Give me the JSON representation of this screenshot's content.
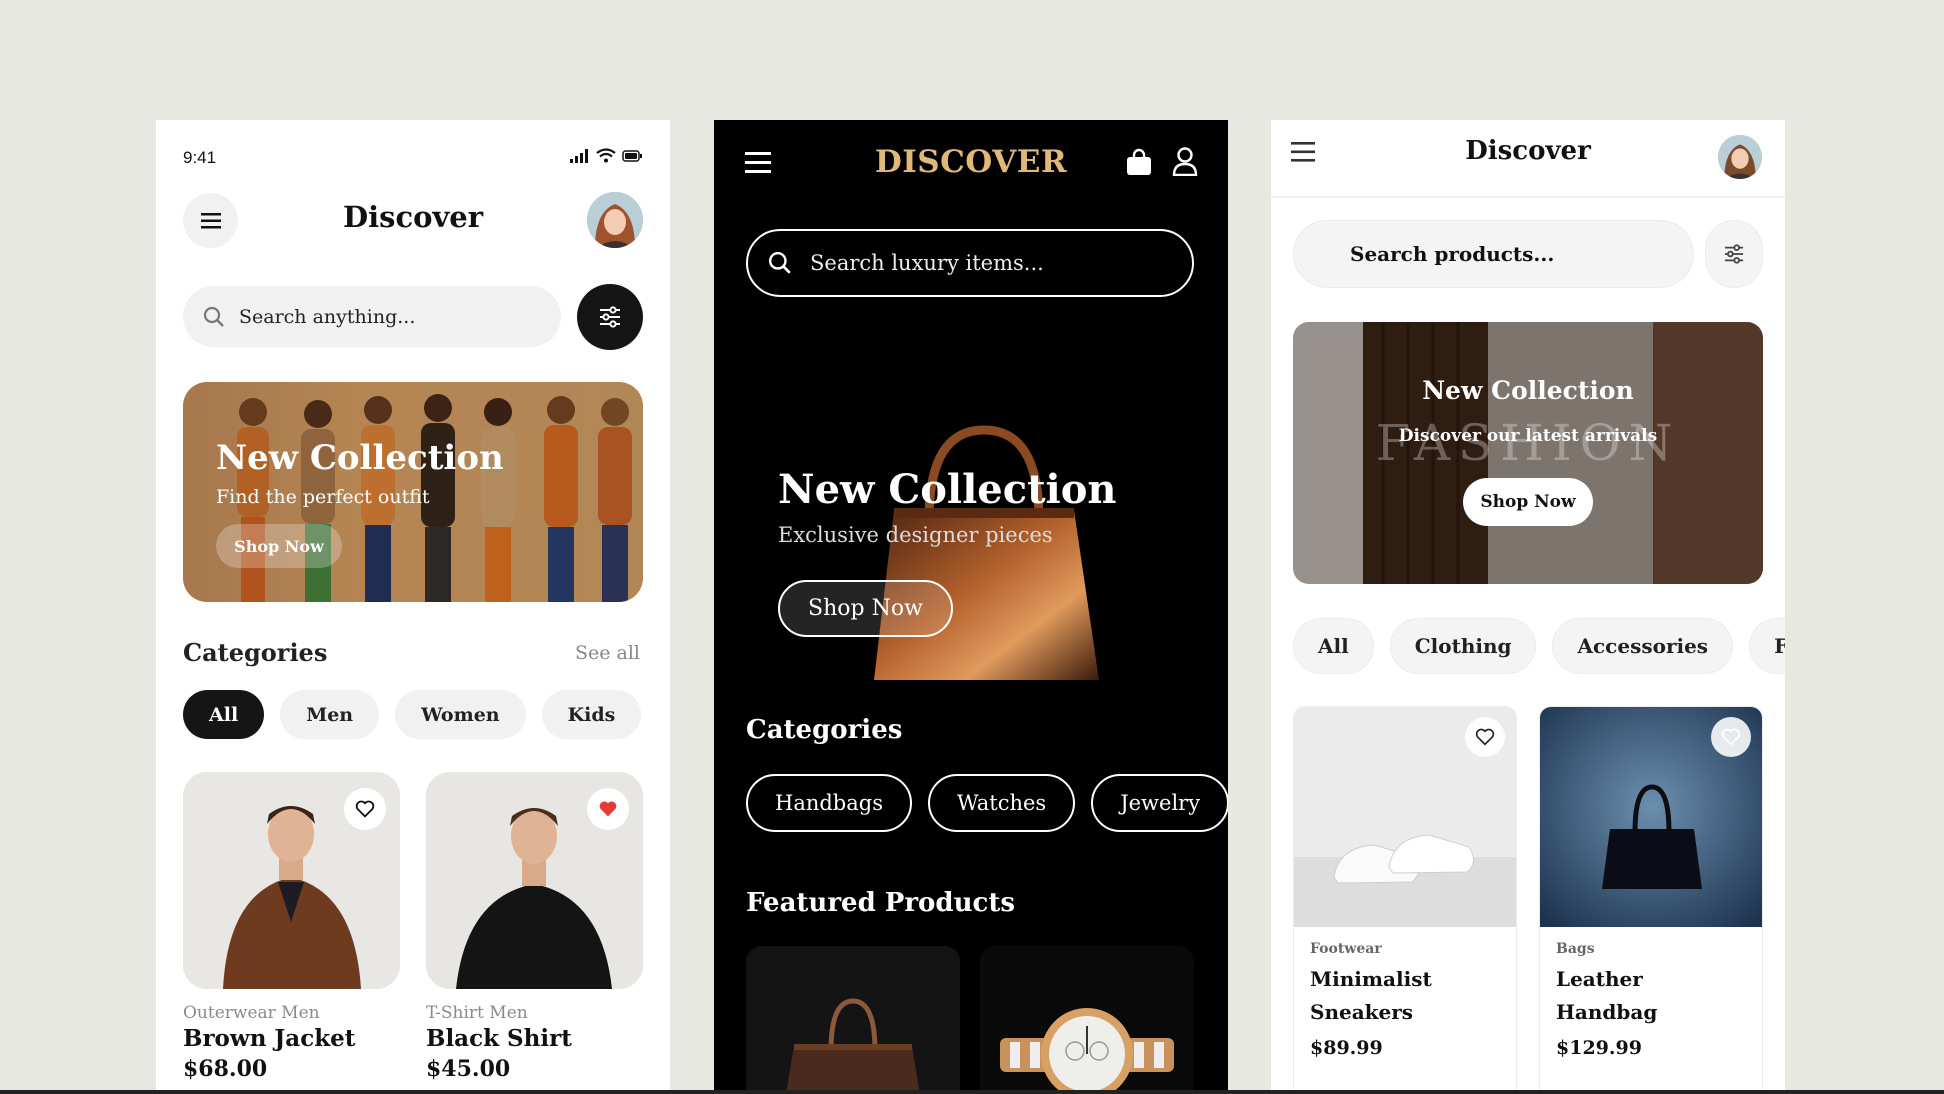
{
  "phone1": {
    "time": "9:41",
    "title": "Discover",
    "search_placeholder": "Search anything...",
    "banner": {
      "title": "New Collection",
      "subtitle": "Find the perfect outfit",
      "button": "Shop Now"
    },
    "categories_title": "Categories",
    "see_all": "See all",
    "chips": [
      "All",
      "Men",
      "Women",
      "Kids"
    ],
    "products": [
      {
        "category": "Outerwear Men",
        "name": "Brown Jacket",
        "price": "$68.00",
        "favorited": false
      },
      {
        "category": "T-Shirt Men",
        "name": "Black Shirt",
        "price": "$45.00",
        "favorited": true
      }
    ]
  },
  "phone2": {
    "brand": "DISCOVER",
    "search_placeholder": "Search luxury items...",
    "hero": {
      "title": "New Collection",
      "subtitle": "Exclusive designer pieces",
      "button": "Shop Now"
    },
    "categories_title": "Categories",
    "chips": [
      "Handbags",
      "Watches",
      "Jewelry"
    ],
    "featured_title": "Featured Products"
  },
  "phone3": {
    "title": "Discover",
    "search_placeholder": "Search products...",
    "banner": {
      "title": "New Collection",
      "subtitle": "Discover our latest arrivals",
      "button": "Shop Now",
      "watermark": "FASHION"
    },
    "chips": [
      "All",
      "Clothing",
      "Accessories",
      "Footwear"
    ],
    "products": [
      {
        "category": "Footwear",
        "name": "Minimalist Sneakers",
        "price": "$89.99"
      },
      {
        "category": "Bags",
        "name": "Leather Handbag",
        "price": "$129.99"
      }
    ]
  },
  "colors": {
    "background": "#e8e8e3",
    "dark": "#151515",
    "gold": "#e0b979",
    "favorite_red": "#e53935"
  }
}
